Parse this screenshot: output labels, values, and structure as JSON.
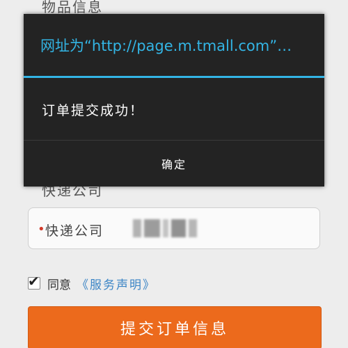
{
  "background": {
    "section_title_top": "物品信息",
    "section_title_mid": "快递公司",
    "courier_field": {
      "required_marker": "•",
      "label": "快递公司"
    },
    "agree": {
      "checked": true,
      "check_glyph": "✔",
      "text": "同意",
      "link": "《服务声明》"
    },
    "submit_label": "提交订单信息"
  },
  "dialog": {
    "title": "网址为“http://page.m.tmall.com”…",
    "message": "订单提交成功！",
    "ok_label": "确定"
  },
  "colors": {
    "accent_blue": "#33b5e5",
    "submit_orange": "#ec6a1c",
    "link_blue": "#3a84c5",
    "dialog_bg": "#232323"
  }
}
